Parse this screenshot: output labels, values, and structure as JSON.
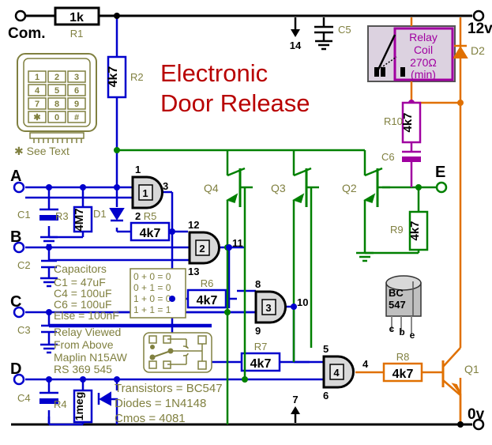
{
  "title": {
    "line1": "Electronic",
    "line2": "Door Release",
    "color": "#b80000"
  },
  "terminals": {
    "com": "Com.",
    "v12": "12v",
    "v0": "0v",
    "e": "E",
    "a": "A",
    "b": "B",
    "c": "C",
    "d": "D"
  },
  "keypad": {
    "keys": [
      "1",
      "2",
      "3",
      "4",
      "5",
      "6",
      "7",
      "8",
      "9",
      "✱",
      "0",
      "#"
    ],
    "note": "✱ See Text"
  },
  "resistors": [
    {
      "ref": "R1",
      "value": "1k",
      "color": "#000000"
    },
    {
      "ref": "R2",
      "value": "4k7",
      "color": "#0000cc"
    },
    {
      "ref": "R3",
      "value": "4M7",
      "color": "#0000cc"
    },
    {
      "ref": "R4",
      "value": "1meg",
      "color": "#0000cc"
    },
    {
      "ref": "R5",
      "value": "4k7",
      "color": "#0000cc"
    },
    {
      "ref": "R6",
      "value": "4k7",
      "color": "#0000cc"
    },
    {
      "ref": "R7",
      "value": "4k7",
      "color": "#0000cc"
    },
    {
      "ref": "R8",
      "value": "4k7",
      "color": "#e07000"
    },
    {
      "ref": "R9",
      "value": "4k7",
      "color": "#008000"
    },
    {
      "ref": "R10",
      "value": "4k7",
      "color": "#a000a0"
    }
  ],
  "capacitors": [
    {
      "ref": "C1"
    },
    {
      "ref": "C2"
    },
    {
      "ref": "C3"
    },
    {
      "ref": "C4"
    },
    {
      "ref": "C5"
    },
    {
      "ref": "C6"
    }
  ],
  "diodes": [
    {
      "ref": "D1"
    },
    {
      "ref": "D2"
    }
  ],
  "transistors": [
    {
      "ref": "Q1"
    },
    {
      "ref": "Q2"
    },
    {
      "ref": "Q3"
    },
    {
      "ref": "Q4"
    }
  ],
  "relay": {
    "label_1": "Relay",
    "label_2": "Coil",
    "label_3": "270Ω",
    "label_4": "(min)",
    "color": "#a000a0"
  },
  "gates": [
    {
      "num": "1",
      "in1": "1",
      "in2": "2",
      "out": "3"
    },
    {
      "num": "2",
      "in1": "12",
      "in2": "13",
      "out": "11"
    },
    {
      "num": "3",
      "in1": "8",
      "in2": "9",
      "out": "10"
    },
    {
      "num": "4",
      "in1": "5",
      "in2": "6",
      "out": "4"
    }
  ],
  "power_pins": {
    "vdd": "14",
    "vss": "7"
  },
  "notes": {
    "caps_heading": "Capacitors",
    "caps_lines": [
      "C1   =   47uF",
      "C4   = 100uF",
      "C6   = 100uF",
      "Else = 100nF"
    ],
    "truth_table": [
      "0 + 0 = 0",
      "0 + 1 = 0",
      "1 + 0 = 0",
      "1 + 1 = 1"
    ],
    "relay_lines": [
      "Relay   Viewed",
      "From      Above",
      "Maplin N15AW",
      "RS     369 545"
    ],
    "parts_lines": [
      "Transistors =   BC547",
      "Diodes        = 1N4148",
      "Cmos        =      4081"
    ],
    "color": "#808040"
  },
  "package": {
    "line1": "BC",
    "line2": "547",
    "pins": [
      "c",
      "b",
      "e"
    ]
  }
}
